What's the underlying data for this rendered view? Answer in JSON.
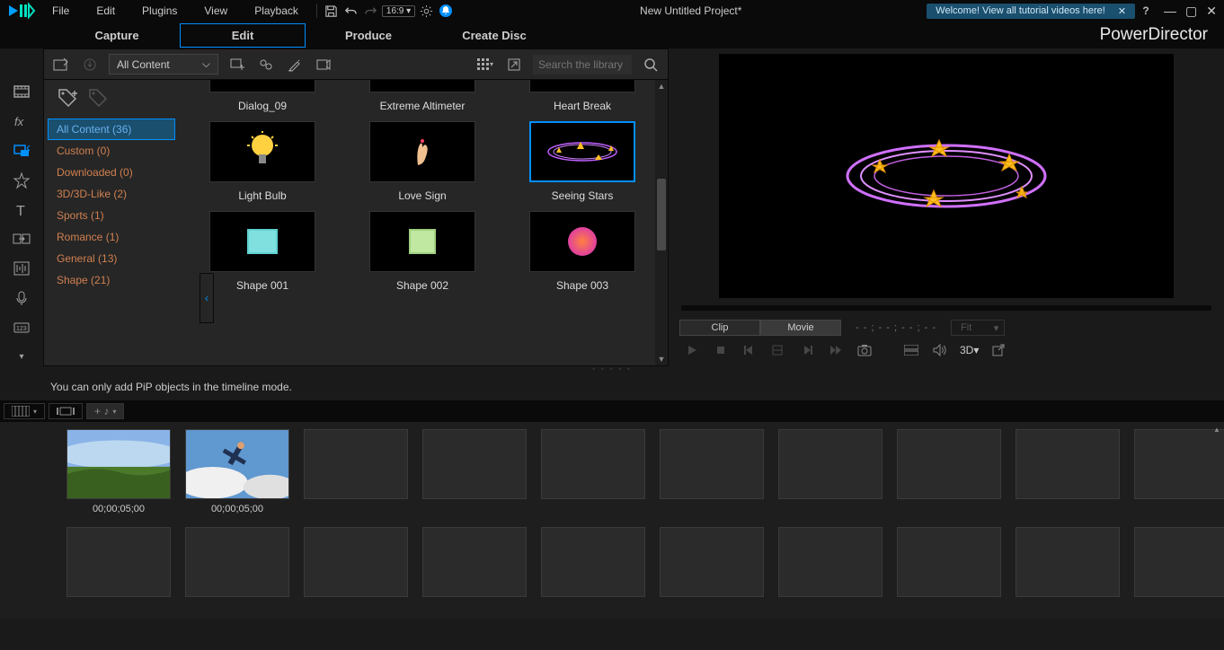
{
  "menubar": {
    "items": [
      "File",
      "Edit",
      "Plugins",
      "View",
      "Playback"
    ],
    "aspect": "16:9",
    "title": "New Untitled Project*",
    "welcome": "Welcome! View all tutorial videos here!"
  },
  "modebar": {
    "modes": [
      "Capture",
      "Edit",
      "Produce",
      "Create Disc"
    ],
    "active": 1,
    "brand": "PowerDirector"
  },
  "library": {
    "dropdown": "All Content",
    "searchPlaceholder": "Search the library",
    "tags": [
      {
        "label": "All Content (36)",
        "active": true
      },
      {
        "label": "Custom  (0)"
      },
      {
        "label": "Downloaded  (0)"
      },
      {
        "label": "3D/3D-Like  (2)"
      },
      {
        "label": "Sports  (1)"
      },
      {
        "label": "Romance  (1)"
      },
      {
        "label": "General  (13)"
      },
      {
        "label": "Shape  (21)"
      }
    ],
    "thumbs": {
      "row0": [
        {
          "label": "Dialog_09"
        },
        {
          "label": "Extreme Altimeter"
        },
        {
          "label": "Heart Break"
        }
      ],
      "row1": [
        {
          "label": "Light Bulb",
          "kind": "bulb"
        },
        {
          "label": "Love Sign",
          "kind": "love"
        },
        {
          "label": "Seeing Stars",
          "kind": "stars",
          "selected": true
        }
      ],
      "row2": [
        {
          "label": "Shape 001",
          "kind": "shape-teal"
        },
        {
          "label": "Shape 002",
          "kind": "shape-green"
        },
        {
          "label": "Shape 003",
          "kind": "shape-grad"
        }
      ]
    }
  },
  "preview": {
    "clip": "Clip",
    "movie": "Movie",
    "timecode": "- - ; - - ; - - ; - -",
    "fit": "Fit",
    "threeD": "3D"
  },
  "timeline": {
    "hint": "You can only add PiP objects in the timeline mode.",
    "slots": [
      {
        "duration": "00;00;05;00",
        "kind": "landscape"
      },
      {
        "duration": "00;00;05;00",
        "kind": "skydive"
      }
    ]
  }
}
